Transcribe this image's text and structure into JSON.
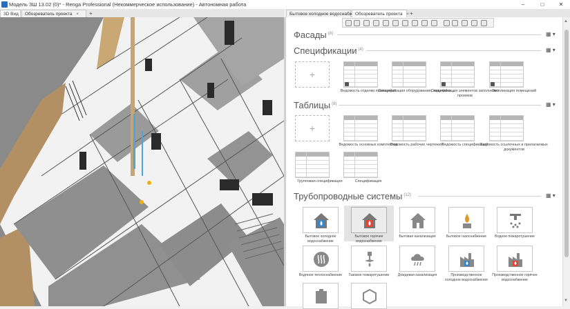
{
  "window": {
    "title": "Модель ЗШ 13.02 (0)* - Renga Professional (Некоммерческое использование) - Автономная работа",
    "minimize": "–",
    "maximize": "□",
    "close": "✕"
  },
  "tabs_left": [
    {
      "label": "3D Вид",
      "close": "×"
    },
    {
      "label": "Обозреватель проекта",
      "close": "×"
    },
    {
      "label": "+"
    }
  ],
  "tabs_right": [
    {
      "label": "Бытовое холодное водоснабжение",
      "close": "×"
    },
    {
      "label": "Обозреватель проекта",
      "close": "×"
    },
    {
      "label": "+"
    }
  ],
  "sections": {
    "facades": {
      "title": "Фасады",
      "count": "(8)",
      "menu": "▦ ▾"
    },
    "specifications": {
      "title": "Спецификации",
      "count": "(4)",
      "menu": "▦ ▾",
      "items": [
        {
          "label": "",
          "type": "add"
        },
        {
          "label": "Ведомость отделки помещений",
          "type": "table"
        },
        {
          "label": "Спецификация оборудования, изделий и ...",
          "type": "table"
        },
        {
          "label": "Спецификация элементов заполнения проемов",
          "type": "table"
        },
        {
          "label": "Экспликация помещений",
          "type": "table"
        }
      ]
    },
    "tables": {
      "title": "Таблицы",
      "count": "(8)",
      "menu": "▦ ▾",
      "items": [
        {
          "label": "",
          "type": "add"
        },
        {
          "label": "Ведомость основных комплектов",
          "type": "table"
        },
        {
          "label": "Ведомость рабочих чертежей",
          "type": "table"
        },
        {
          "label": "Ведомость спецификаций",
          "type": "table"
        },
        {
          "label": "Ведомость ссылочных и прилагаемых документов",
          "type": "table"
        },
        {
          "label": "Групповая спецификация",
          "type": "table"
        },
        {
          "label": "Спецификация",
          "type": "table"
        }
      ]
    },
    "pipe_systems": {
      "title": "Трубопроводные системы",
      "count": "(12)",
      "menu": "▦ ▾",
      "items": [
        {
          "label": "Бытовое холодное водоснабжение",
          "icon": "cold-water-house-icon",
          "color": "#3a86c8"
        },
        {
          "label": "Бытовое горячее водоснабжение",
          "icon": "hot-water-house-icon",
          "color": "#e0463a",
          "selected": true
        },
        {
          "label": "Бытовая канализация",
          "icon": "sewer-house-icon",
          "color": "#888888"
        },
        {
          "label": "Бытовое газоснабжение",
          "icon": "gas-flame-icon",
          "color": "#e09a2a"
        },
        {
          "label": "Водное пожаротушение",
          "icon": "sprinkler-icon",
          "color": "#777777"
        },
        {
          "label": "Водяное теплоснабжение",
          "icon": "heating-radiator-icon",
          "color": "#888888"
        },
        {
          "label": "Газовое пожаротушение",
          "icon": "gas-sprinkler-icon",
          "color": "#888888"
        },
        {
          "label": "Дождевая канализация",
          "icon": "rain-cloud-icon",
          "color": "#888888"
        },
        {
          "label": "Производственное холодное водоснабжение",
          "icon": "factory-cold-water-icon",
          "color": "#3a86c8"
        },
        {
          "label": "Производственное горячее водоснабжение",
          "icon": "factory-hot-water-icon",
          "color": "#e0463a"
        },
        {
          "label": "",
          "icon": "pipe-system-icon",
          "color": "#888888"
        },
        {
          "label": "",
          "icon": "custom-system-icon",
          "color": "#888888"
        }
      ]
    }
  }
}
